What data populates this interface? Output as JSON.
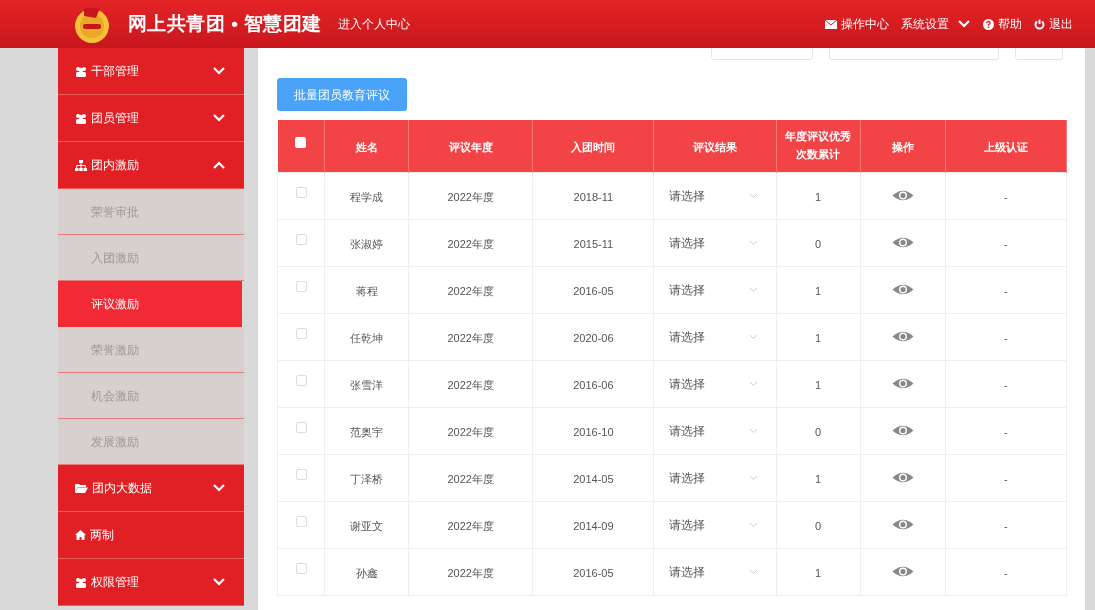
{
  "header": {
    "title": "网上共青团 • 智慧团建",
    "personal_link": "进入个人中心",
    "nav": [
      {
        "label": "操作中心",
        "kind": "mail"
      },
      {
        "label": "系统设置",
        "kind": "dropdown"
      },
      {
        "label": "帮助",
        "kind": "help"
      },
      {
        "label": "退出",
        "kind": "power"
      }
    ]
  },
  "sidebar": {
    "items": [
      {
        "label": "干部管理",
        "expanded": false
      },
      {
        "label": "团员管理",
        "expanded": false
      },
      {
        "label": "团内激励",
        "expanded": true,
        "children": [
          {
            "label": "荣誉审批",
            "selected": false
          },
          {
            "label": "入团激励",
            "selected": false
          },
          {
            "label": "评议激励",
            "selected": true
          },
          {
            "label": "荣誉激励",
            "selected": false
          },
          {
            "label": "机会激励",
            "selected": false
          },
          {
            "label": "发展激励",
            "selected": false
          }
        ]
      },
      {
        "label": "团内大数据",
        "expanded": false
      },
      {
        "label": "两制",
        "kind": "link"
      },
      {
        "label": "权限管理",
        "expanded": false
      }
    ]
  },
  "batch_button": "批量团员教育评议",
  "table": {
    "select_all_checked": false,
    "columns": [
      "姓名",
      "评议年度",
      "入团时间",
      "评议结果",
      "年度评议优秀次数累计",
      "操作",
      "上级认证"
    ],
    "rows": [
      {
        "checked": false,
        "name": "程学成",
        "year": "2022年度",
        "joined": "2018-11",
        "result_placeholder": "请选择",
        "count": "1",
        "certification": "-"
      },
      {
        "checked": false,
        "name": "张淑婷",
        "year": "2022年度",
        "joined": "2015-11",
        "result_placeholder": "请选择",
        "count": "0",
        "certification": "-"
      },
      {
        "checked": false,
        "name": "蒋程",
        "year": "2022年度",
        "joined": "2016-05",
        "result_placeholder": "请选择",
        "count": "1",
        "certification": "-"
      },
      {
        "checked": false,
        "name": "任乾坤",
        "year": "2022年度",
        "joined": "2020-06",
        "result_placeholder": "请选择",
        "count": "1",
        "certification": "-"
      },
      {
        "checked": false,
        "name": "张雪洋",
        "year": "2022年度",
        "joined": "2016-06",
        "result_placeholder": "请选择",
        "count": "1",
        "certification": "-"
      },
      {
        "checked": false,
        "name": "范奥宇",
        "year": "2022年度",
        "joined": "2016-10",
        "result_placeholder": "请选择",
        "count": "0",
        "certification": "-"
      },
      {
        "checked": false,
        "name": "丁泽桥",
        "year": "2022年度",
        "joined": "2014-05",
        "result_placeholder": "请选择",
        "count": "1",
        "certification": "-"
      },
      {
        "checked": false,
        "name": "谢亚文",
        "year": "2022年度",
        "joined": "2014-09",
        "result_placeholder": "请选择",
        "count": "0",
        "certification": "-"
      },
      {
        "checked": false,
        "name": "孙鑫",
        "year": "2022年度",
        "joined": "2016-05",
        "result_placeholder": "请选择",
        "count": "1",
        "certification": "-"
      }
    ]
  }
}
